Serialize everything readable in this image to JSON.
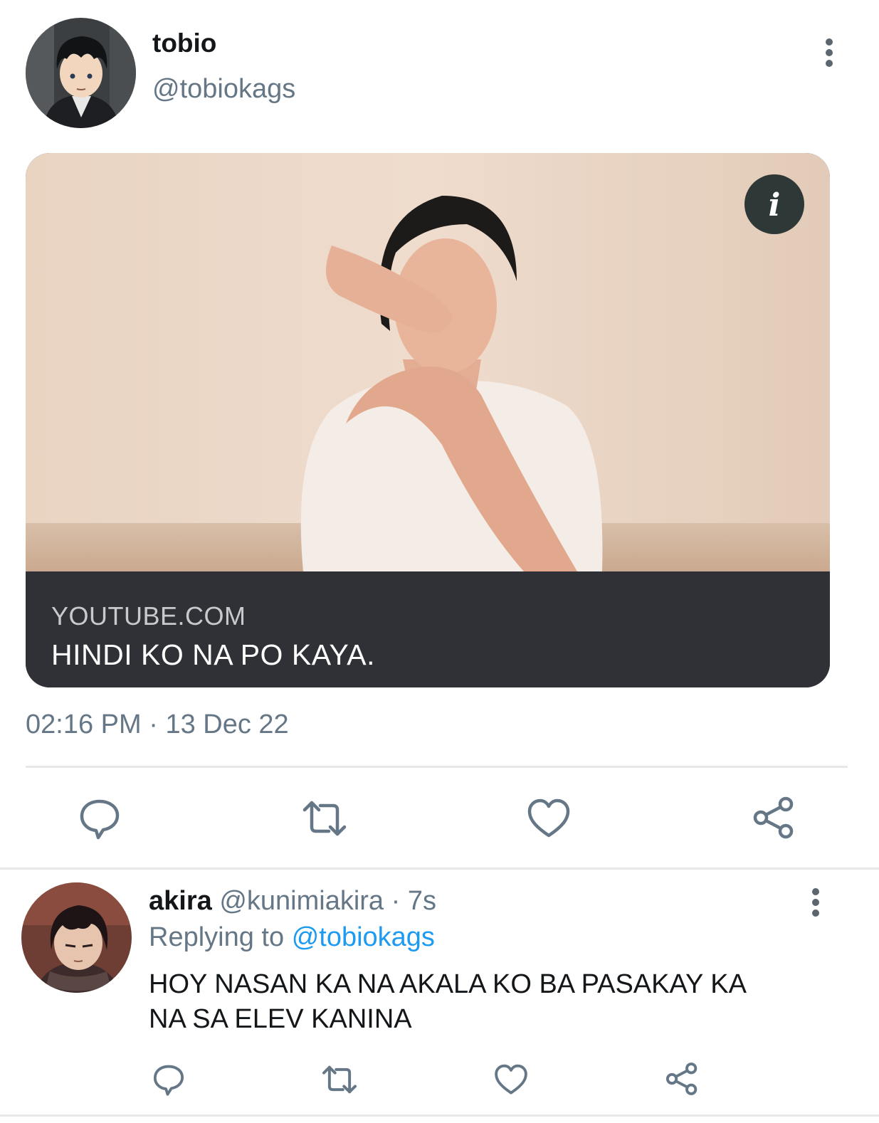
{
  "tweet": {
    "display_name": "tobio",
    "handle": "@tobiokags",
    "card": {
      "domain": "YOUTUBE.COM",
      "title": "HINDI KO NA PO KAYA."
    },
    "timestamp": "02:16 PM",
    "separator": "·",
    "date": "13 Dec 22",
    "actions": [
      "reply-icon",
      "retweet-icon",
      "like-icon",
      "share-icon"
    ],
    "colors": {
      "icon": "#657786",
      "link": "#1d9bf0",
      "card_bar": "#2f3136"
    }
  },
  "reply": {
    "display_name": "akira",
    "handle": "@kunimiakira",
    "separator": "·",
    "time_ago": "7s",
    "replying_prefix": "Replying to",
    "replying_handle": "@tobiokags",
    "text_line1": "HOY NASAN KA NA AKALA KO BA PASAKAY KA",
    "text_line2": "NA SA ELEV KANINA",
    "actions": [
      "reply-icon",
      "retweet-icon",
      "like-icon",
      "share-icon"
    ]
  }
}
